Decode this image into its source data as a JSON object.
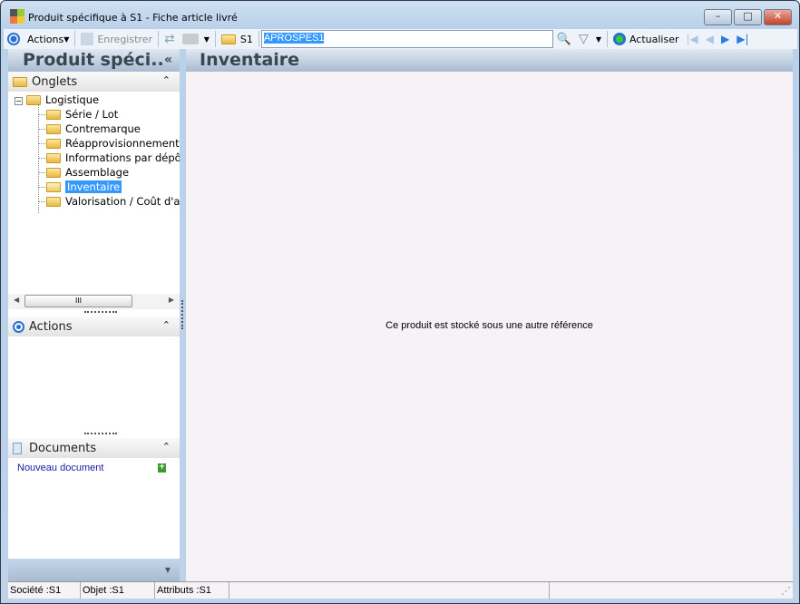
{
  "window": {
    "title": "Produit spécifique à S1 -  Fiche article livré",
    "minimize": "–",
    "maximize": "□",
    "close": "✕"
  },
  "toolbar": {
    "actions_label": "Actions",
    "save_label": "Enregistrer",
    "company_label": "S1",
    "search_value": "APROSPES1",
    "refresh_label": "Actualiser"
  },
  "left": {
    "header": "Produit spéci..",
    "collapse": "«",
    "tabs_section": "Onglets",
    "tree": {
      "root": "Logistique",
      "items": [
        "Série / Lot",
        "Contremarque",
        "Réapprovisionnement",
        "Informations par dépôt",
        "Assemblage",
        "Inventaire",
        "Valorisation / Coût d'achat"
      ],
      "selected": "Inventaire"
    },
    "actions_section": "Actions",
    "documents_section": "Documents",
    "new_document": "Nouveau document"
  },
  "main": {
    "header": "Inventaire",
    "message": "Ce produit est stocké sous une autre référence"
  },
  "status": {
    "company": "Société :S1",
    "object": "Objet :S1",
    "attributes": "Attributs :S1"
  }
}
